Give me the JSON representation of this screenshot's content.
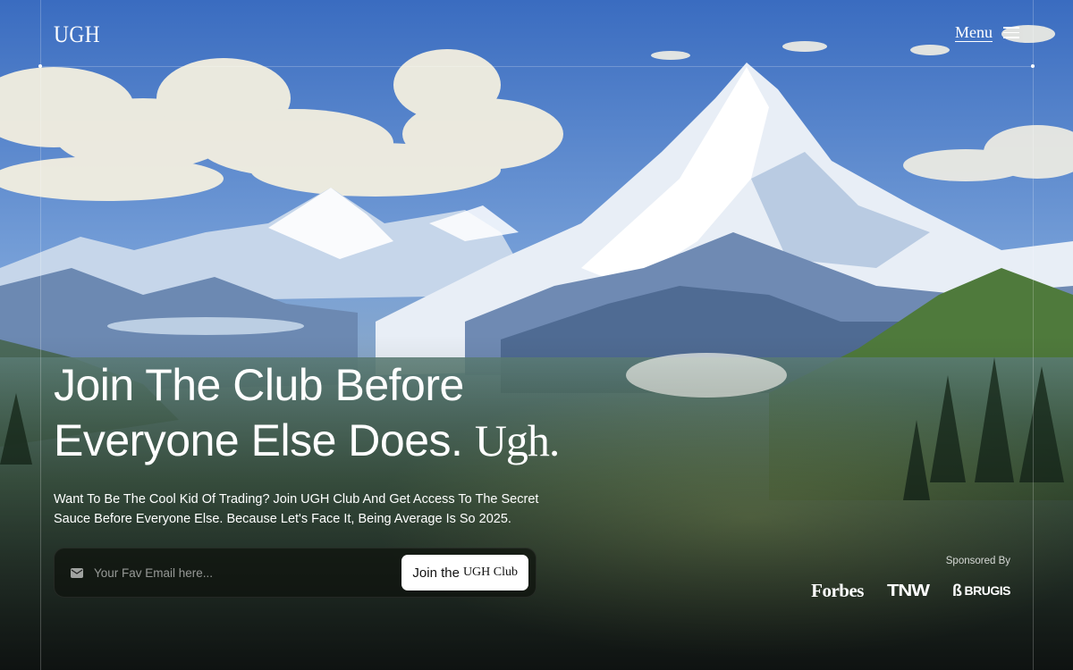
{
  "brand": {
    "logo": "UGH"
  },
  "nav": {
    "menu_label": "Menu"
  },
  "hero": {
    "headline_line1": "Join The Club Before",
    "headline_line2": "Everyone Else Does.",
    "headline_accent": "Ugh.",
    "subheading": "Want To Be The Cool Kid Of Trading? Join UGH Club And Get Access To The Secret Sauce Before Everyone Else. Because Let's Face It, Being Average Is So 2025."
  },
  "signup": {
    "email_placeholder": "Your Fav Email here...",
    "button_prefix": "Join the",
    "button_accent": "UGH Club"
  },
  "sponsors": {
    "label": "Sponsored By",
    "items": [
      "Forbes",
      "TNW",
      "BRUGIS"
    ]
  },
  "icons": {
    "email": "mail-icon",
    "menu": "hamburger-icon"
  }
}
